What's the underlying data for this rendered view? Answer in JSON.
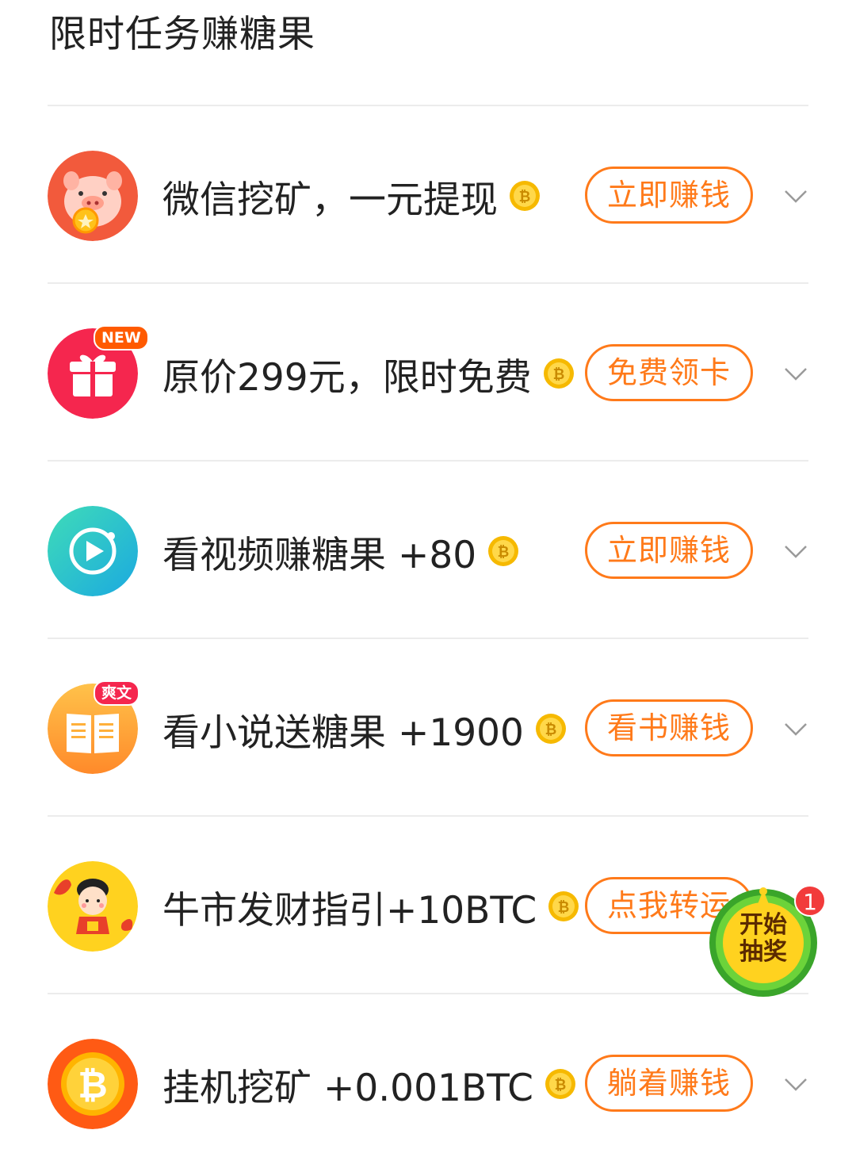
{
  "section": {
    "title": "限时任务赚糖果"
  },
  "tasks": [
    {
      "title": "微信挖矿，一元提现",
      "action": "立即赚钱",
      "icon": "pig-icon"
    },
    {
      "title": "原价299元，限时免费",
      "action": "免费领卡",
      "icon": "gift-icon",
      "badge": "NEW"
    },
    {
      "title": "看视频赚糖果 +80",
      "action": "立即赚钱",
      "icon": "video-icon"
    },
    {
      "title": "看小说送糖果 +1900",
      "action": "看书赚钱",
      "icon": "book-icon",
      "badge": "爽文"
    },
    {
      "title": "牛市发财指引+10BTC",
      "action": "点我转运",
      "icon": "fortune-boy-icon"
    },
    {
      "title": "挂机挖矿  +0.001BTC",
      "action": "躺着赚钱",
      "icon": "bitcoin-icon"
    }
  ],
  "floating_button": {
    "line1": "开始",
    "line2": "抽奖",
    "count": "1"
  },
  "colors": {
    "accent": "#ff7a1a",
    "divider": "#ececec",
    "badge_red": "#f23b3b"
  }
}
